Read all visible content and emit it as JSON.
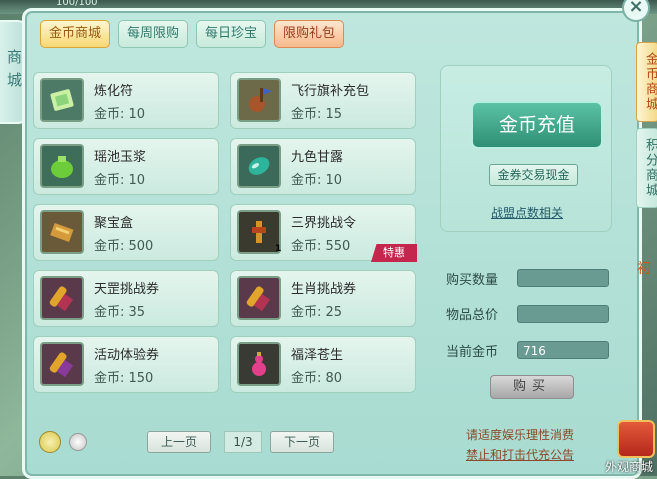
{
  "top_counter": "100/100",
  "left_side_tab": "商城",
  "tabs": [
    {
      "label": "金币商城",
      "state": "active"
    },
    {
      "label": "每周限购",
      "state": "normal"
    },
    {
      "label": "每日珍宝",
      "state": "normal"
    },
    {
      "label": "限购礼包",
      "state": "limited"
    }
  ],
  "items": [
    {
      "name": "炼化符",
      "price": "金币: 10",
      "icon": "talisman-icon"
    },
    {
      "name": "飞行旗补充包",
      "price": "金币: 15",
      "icon": "flag-bag-icon"
    },
    {
      "name": "瑶池玉浆",
      "price": "金币: 10",
      "icon": "jade-pot-icon"
    },
    {
      "name": "九色甘露",
      "price": "金币: 10",
      "icon": "dew-gem-icon"
    },
    {
      "name": "聚宝盒",
      "price": "金币: 500",
      "icon": "treasure-box-icon"
    },
    {
      "name": "三界挑战令",
      "price": "金币: 550",
      "icon": "challenge-token-icon",
      "badge": "特惠",
      "count": "1"
    },
    {
      "name": "天罡挑战券",
      "price": "金币: 35",
      "icon": "scroll-icon"
    },
    {
      "name": "生肖挑战券",
      "price": "金币: 25",
      "icon": "scroll-icon"
    },
    {
      "name": "活动体验券",
      "price": "金币: 150",
      "icon": "scroll-icon"
    },
    {
      "name": "福泽苍生",
      "price": "金币: 80",
      "icon": "gourd-icon"
    }
  ],
  "recharge_button": "金币充值",
  "voucher_button": "金券交易现金",
  "alliance_link": "战盟点数相关",
  "fields": {
    "quantity_label": "购买数量",
    "quantity_value": "",
    "total_label": "物品总价",
    "total_value": "",
    "current_gold_label": "当前金币",
    "current_gold_value": "716"
  },
  "buy_button": "购买",
  "notice_line1": "请适度娱乐理性消费",
  "notice_line2": "禁止和打击代充公告",
  "pager": {
    "prev": "上一页",
    "indicator": "1/3",
    "next": "下一页"
  },
  "right_tabs": [
    {
      "label": "金币商城",
      "state": "active"
    },
    {
      "label": "积分商城",
      "state": "inactive"
    }
  ],
  "outside_shop_label": "外观商城",
  "edge_text": "初"
}
